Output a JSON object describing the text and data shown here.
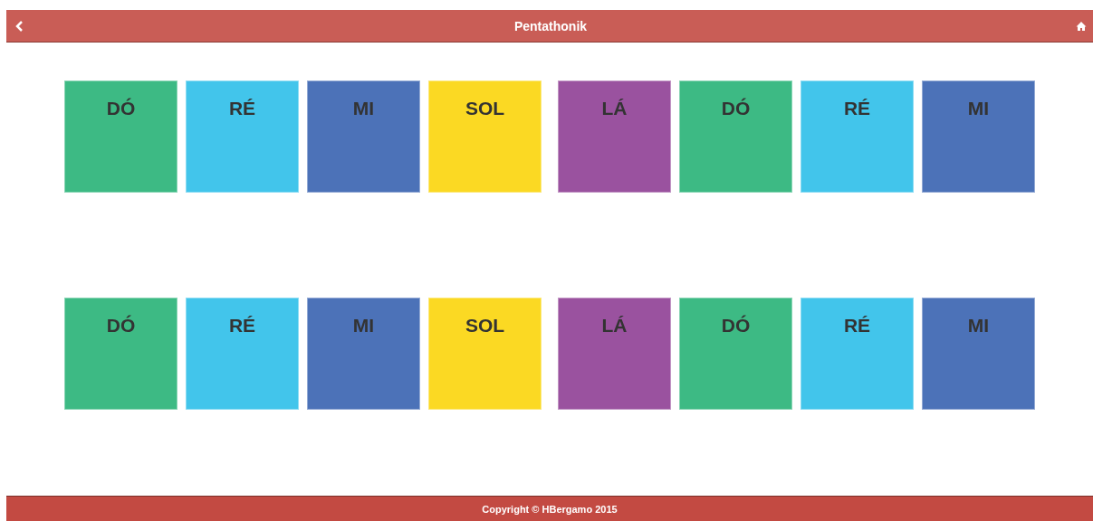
{
  "header": {
    "title": "Pentathonik"
  },
  "rows": [
    {
      "groups": [
        [
          {
            "label": "DÓ",
            "color": "#3dba84"
          },
          {
            "label": "RÉ",
            "color": "#42c5eb"
          },
          {
            "label": "MI",
            "color": "#4c72b8"
          },
          {
            "label": "SOL",
            "color": "#fbd923"
          }
        ],
        [
          {
            "label": "LÁ",
            "color": "#9a529f"
          },
          {
            "label": "DÓ",
            "color": "#3dba84"
          },
          {
            "label": "RÉ",
            "color": "#42c5eb"
          },
          {
            "label": "MI",
            "color": "#4c72b8"
          }
        ]
      ]
    },
    {
      "groups": [
        [
          {
            "label": "DÓ",
            "color": "#3dba84"
          },
          {
            "label": "RÉ",
            "color": "#42c5eb"
          },
          {
            "label": "MI",
            "color": "#4c72b8"
          },
          {
            "label": "SOL",
            "color": "#fbd923"
          }
        ],
        [
          {
            "label": "LÁ",
            "color": "#9a529f"
          },
          {
            "label": "DÓ",
            "color": "#3dba84"
          },
          {
            "label": "RÉ",
            "color": "#42c5eb"
          },
          {
            "label": "MI",
            "color": "#4c72b8"
          }
        ]
      ]
    }
  ],
  "footer": {
    "text": "Copyright © HBergamo 2015"
  }
}
